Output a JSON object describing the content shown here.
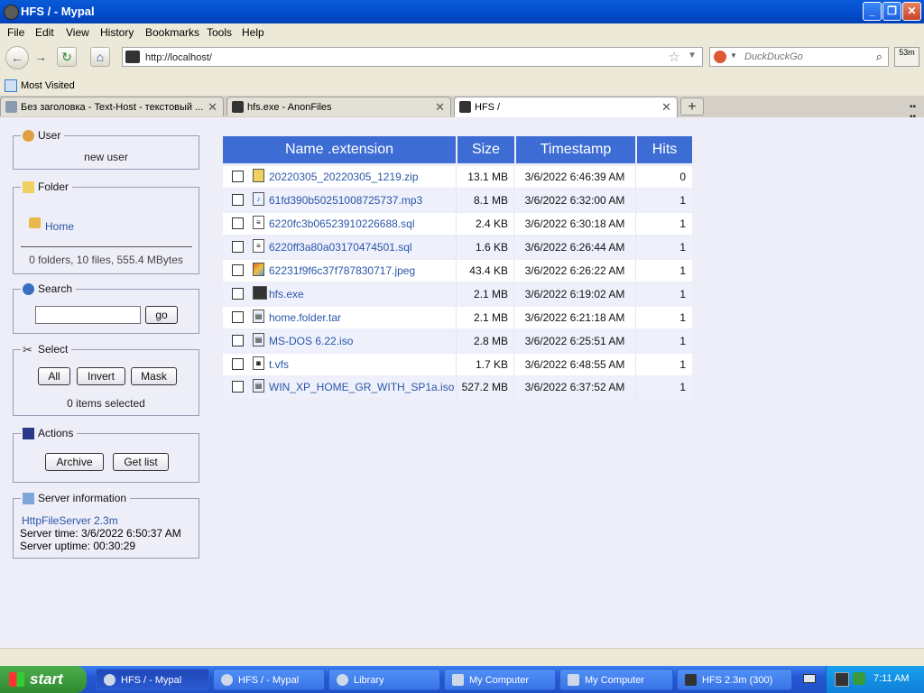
{
  "window": {
    "title": "HFS / - Mypal",
    "minimize": "_",
    "maximize": "❐",
    "close": "✕"
  },
  "menu": [
    "File",
    "Edit",
    "View",
    "History",
    "Bookmarks",
    "Tools",
    "Help"
  ],
  "nav": {
    "back": "←",
    "forward": "→",
    "reload": "↻",
    "home": "⌂",
    "url": "http://localhost/",
    "search_placeholder": "DuckDuckGo",
    "addon_label": "53m"
  },
  "bookmarks": {
    "label": "Most Visited"
  },
  "tabs": [
    {
      "label": "Без заголовка - Text-Host - текстовый ...",
      "close": "✕"
    },
    {
      "label": "hfs.exe - AnonFiles",
      "close": "✕"
    },
    {
      "label": "HFS /",
      "close": "✕"
    }
  ],
  "newtab": "+",
  "sidebar": {
    "user": {
      "title": "User",
      "name": "new user"
    },
    "folder": {
      "title": "Folder",
      "home": "Home",
      "summary": "0 folders, 10 files, 555.4 MBytes"
    },
    "search": {
      "title": "Search",
      "go": "go"
    },
    "select": {
      "title": "Select",
      "all": "All",
      "invert": "Invert",
      "mask": "Mask",
      "status": "0 items selected"
    },
    "actions": {
      "title": "Actions",
      "archive": "Archive",
      "getlist": "Get list"
    },
    "server": {
      "title": "Server information",
      "version": "HttpFileServer 2.3m",
      "time": "Server time: 3/6/2022 6:50:37 AM",
      "uptime": "Server uptime: 00:30:29"
    }
  },
  "table": {
    "headers": {
      "name": "Name .extension",
      "size": "Size",
      "timestamp": "Timestamp",
      "hits": "Hits"
    },
    "rows": [
      {
        "name": "20220305_20220305_1219.zip",
        "size": "13.1 MB",
        "timestamp": "3/6/2022 6:46:39 AM",
        "hits": "0"
      },
      {
        "name": "61fd390b50251008725737.mp3",
        "size": "8.1 MB",
        "timestamp": "3/6/2022 6:32:00 AM",
        "hits": "1"
      },
      {
        "name": "6220fc3b06523910226688.sql",
        "size": "2.4 KB",
        "timestamp": "3/6/2022 6:30:18 AM",
        "hits": "1"
      },
      {
        "name": "6220ff3a80a03170474501.sql",
        "size": "1.6 KB",
        "timestamp": "3/6/2022 6:26:44 AM",
        "hits": "1"
      },
      {
        "name": "62231f9f6c37f787830717.jpeg",
        "size": "43.4 KB",
        "timestamp": "3/6/2022 6:26:22 AM",
        "hits": "1"
      },
      {
        "name": "hfs.exe",
        "size": "2.1 MB",
        "timestamp": "3/6/2022 6:19:02 AM",
        "hits": "1"
      },
      {
        "name": "home.folder.tar",
        "size": "2.1 MB",
        "timestamp": "3/6/2022 6:21:18 AM",
        "hits": "1"
      },
      {
        "name": "MS-DOS 6.22.iso",
        "size": "2.8 MB",
        "timestamp": "3/6/2022 6:25:51 AM",
        "hits": "1"
      },
      {
        "name": "t.vfs",
        "size": "1.7 KB",
        "timestamp": "3/6/2022 6:48:55 AM",
        "hits": "1"
      },
      {
        "name": "WIN_XP_HOME_GR_WITH_SP1a.iso",
        "size": "527.2 MB",
        "timestamp": "3/6/2022 6:37:52 AM",
        "hits": "1"
      }
    ]
  },
  "taskbar": {
    "start": "start",
    "items": [
      "HFS / - Mypal",
      "HFS / - Mypal",
      "Library",
      "My Computer",
      "My Computer",
      "HFS 2.3m (300)"
    ],
    "time": "7:11 AM"
  }
}
